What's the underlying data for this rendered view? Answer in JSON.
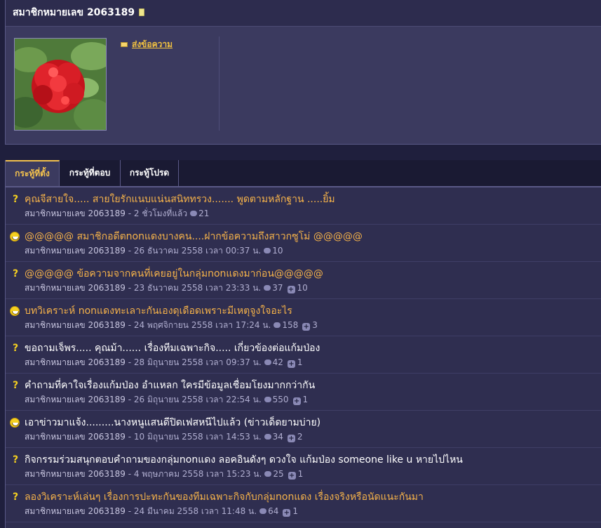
{
  "profile": {
    "title": "สมาชิกหมายเลข 2063189",
    "send_message": "ส่งข้อความ"
  },
  "tabs": [
    {
      "label": "กระทู้ที่ตั้ง"
    },
    {
      "label": "กระทู้ที่ตอบ"
    },
    {
      "label": "กระทู้โปรด"
    }
  ],
  "threads": [
    {
      "title": "คุณจีสายใจ..... สายใยรักแนบแน่นสนิททรวง....... พูดตามหลักฐาน .....ยิ้ม",
      "member": "สมาชิกหมายเลข 2063189",
      "time": "- 2 ชั่วโมงที่แล้ว",
      "comments": "21",
      "votes": ""
    },
    {
      "title": "@@@@@ สมาชิกอดีตnonแดงบางคน....ฝากข้อความถึงสาวกซูโม่ @@@@@",
      "member": "สมาชิกหมายเลข 2063189",
      "time": "- 26 ธันวาคม 2558 เวลา 00:37 น.",
      "comments": "10",
      "votes": ""
    },
    {
      "title": "@@@@@ ข้อความจากคนที่เคยอยู่ในกลุ่มnonแดงมาก่อน@@@@@",
      "member": "สมาชิกหมายเลข 2063189",
      "time": "- 23 ธันวาคม 2558 เวลา 23:33 น.",
      "comments": "37",
      "votes": "10"
    },
    {
      "title": "บทวิเคราะห์ nonแดงทะเลาะกันเองดุเดือดเพราะมีเหตุจูงใจอะไร",
      "member": "สมาชิกหมายเลข 2063189",
      "time": "- 24 พฤศจิกายน 2558 เวลา 17:24 น.",
      "comments": "158",
      "votes": "3"
    },
    {
      "title": "ขอถามเจ็พร..... คุณม้า...... เรื่องทีมเฉพาะกิจ..... เกี่ยวข้องต่อแก้มป่อง",
      "member": "สมาชิกหมายเลข 2063189",
      "time": "- 28 มิถุนายน 2558 เวลา 09:37 น.",
      "comments": "42",
      "votes": "1"
    },
    {
      "title": "คำถามที่คาใจเรื่องแก้มป่อง อำแหลก ใครมีข้อมูลเชื่อมโยงมากกว่ากัน",
      "member": "สมาชิกหมายเลข 2063189",
      "time": "- 26 มิถุนายน 2558 เวลา 22:54 น.",
      "comments": "550",
      "votes": "1"
    },
    {
      "title": "เอาข่าวมาแจ้ง.........นางหนูแสนดีปิดเฟสหนีไปแล้ว (ข่าวเด็ดยามบ่าย)",
      "member": "สมาชิกหมายเลข 2063189",
      "time": "- 10 มิถุนายน 2558 เวลา 14:53 น.",
      "comments": "34",
      "votes": "2"
    },
    {
      "title": "กิจกรรมร่วมสนุกตอบคำถามของกลุ่มnonแดง ลอคอินดังๆ ดวงใจ แก้มป่อง someone like u หายไปไหน",
      "member": "สมาชิกหมายเลข 2063189",
      "time": "- 4 พฤษภาคม 2558 เวลา 15:23 น.",
      "comments": "25",
      "votes": "1"
    },
    {
      "title": "ลองวิเคราะห์เล่นๆ เรื่องการปะทะกันของทีมเฉพาะกิจกับกลุ่มnonแดง เรื่องจริงหรือนัดแนะกันมา",
      "member": "สมาชิกหมายเลข 2063189",
      "time": "- 24 มีนาคม 2558 เวลา 11:48 น.",
      "comments": "64",
      "votes": "1"
    }
  ]
}
